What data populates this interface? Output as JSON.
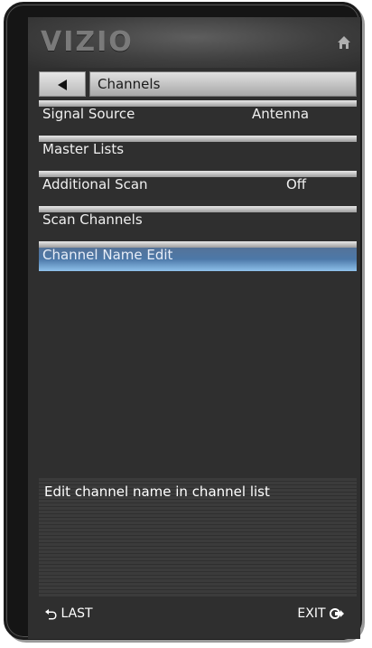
{
  "brand": "VIZIO",
  "header": {
    "home_icon": "home-icon",
    "back_icon": "left-triangle-icon",
    "title": "Channels"
  },
  "menu": {
    "items": [
      {
        "label": "Signal Source",
        "value": "Antenna"
      },
      {
        "label": "Master Lists",
        "value": ""
      },
      {
        "label": "Additional Scan",
        "value": "Off"
      },
      {
        "label": "Scan Channels",
        "value": ""
      },
      {
        "label": "Channel Name Edit",
        "value": "",
        "selected": true
      }
    ]
  },
  "info": {
    "text": "Edit channel name in channel list"
  },
  "footer": {
    "last_label": "LAST",
    "exit_label": "EXIT",
    "last_icon": "return-arrow-icon",
    "exit_icon": "exit-arrow-icon"
  },
  "colors": {
    "selected_top": "#5a7090",
    "selected_bottom": "#8fc1ea",
    "background": "#2f2f2f"
  }
}
